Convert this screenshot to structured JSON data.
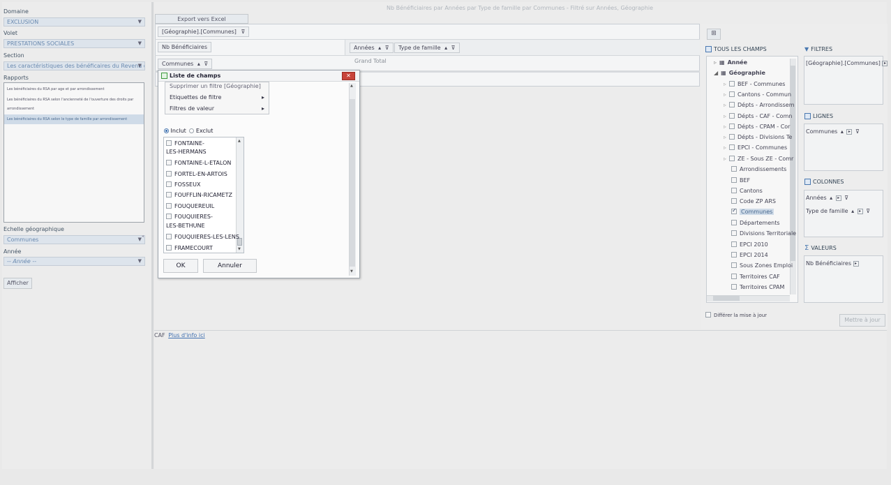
{
  "sidebar": {
    "domaine_label": "Domaine",
    "domaine_value": "EXCLUSION",
    "volet_label": "Volet",
    "volet_value": "PRESTATIONS SOCIALES",
    "section_label": "Section",
    "section_value": "Les caractéristiques des bénéficaires du Revenu de S",
    "rapports_label": "Rapports",
    "rapports": [
      "Les bénéficiaires du RSA par age et par arrondissement",
      "Les bénéficiaires du RSA selon l'ancienneté de l'ouverture des droits par",
      "arrondissement",
      "Les bénéficiaires du RSA selon le type de famille par arrondissement"
    ],
    "echelle_label": "Echelle géographique",
    "echelle_value": "Communes",
    "annee_label": "Année",
    "annee_value": "-- Année --",
    "afficher_label": "Afficher"
  },
  "main": {
    "title": "Nb Bénéficiaires par Années par Type de famille par Communes - Filtré sur Années, Géographie",
    "export_label": "Export vers Excel",
    "filter_chip": "[Géographie].[Communes]",
    "data_chip": "Nb Bénéficiaires",
    "col_chip_1": "Années",
    "col_chip_2": "Type de famille",
    "row_chip": "Communes",
    "grand_total": "Grand Total",
    "footer_prefix": "CAF",
    "footer_link": "Plus d'info ici"
  },
  "dialog": {
    "title": "Liste de champs",
    "menu": [
      "Supprimer un filtre [Géographie]",
      "Etiquettes de filtre",
      "Filtres de valeur"
    ],
    "radio_include": "Inclut",
    "radio_exclude": "Exclut",
    "communes": [
      "FONTAINE-",
      "LES-HERMANS",
      "FONTAINE-L-ETALON",
      "FORTEL-EN-ARTOIS",
      "FOSSEUX",
      "FOUFFLIN-RICAMETZ",
      "FOUQUEREUIL",
      "FOUQUIERES-",
      "LES-BETHUNE",
      "FOUQUIERES-LES-LENS",
      "FRAMECOURT"
    ],
    "ok_label": "OK",
    "cancel_label": "Annuler"
  },
  "field_list": {
    "all_fields_title": "TOUS LES CHAMPS",
    "items": [
      "Année",
      "Géographie",
      "BEF - Communes",
      "Cantons - Commun",
      "Dépts - Arrondissem",
      "Dépts - CAF - Comn",
      "Dépts - CPAM - Cor",
      "Dépts - Divisions Te",
      "EPCI - Communes",
      "ZE - Sous ZE - Comr",
      "Arrondissements",
      "BEF",
      "Cantons",
      "Code ZP ARS",
      "Communes",
      "Départements",
      "Divisions Territoriale",
      "EPCI 2010",
      "EPCI 2014",
      "Sous Zones Emploi",
      "Territoires CAF",
      "Territoires CPAM"
    ],
    "defer_label": "Différer la mise à jour",
    "update_label": "Mettre à jour",
    "filtres_title": "FILTRES",
    "filtres_chip": "[Géographie].[Communes]",
    "lignes_title": "LIGNES",
    "lignes_chip": "Communes",
    "colonnes_title": "COLONNES",
    "colonnes_chip_1": "Années",
    "colonnes_chip_2": "Type de famille",
    "valeurs_title": "VALEURS",
    "valeurs_chip": "Nb Bénéficiaires"
  },
  "colors": {
    "accent": "#4a78b0",
    "selected_row": "#cfdbe8",
    "dialog_close": "#c8443a"
  }
}
